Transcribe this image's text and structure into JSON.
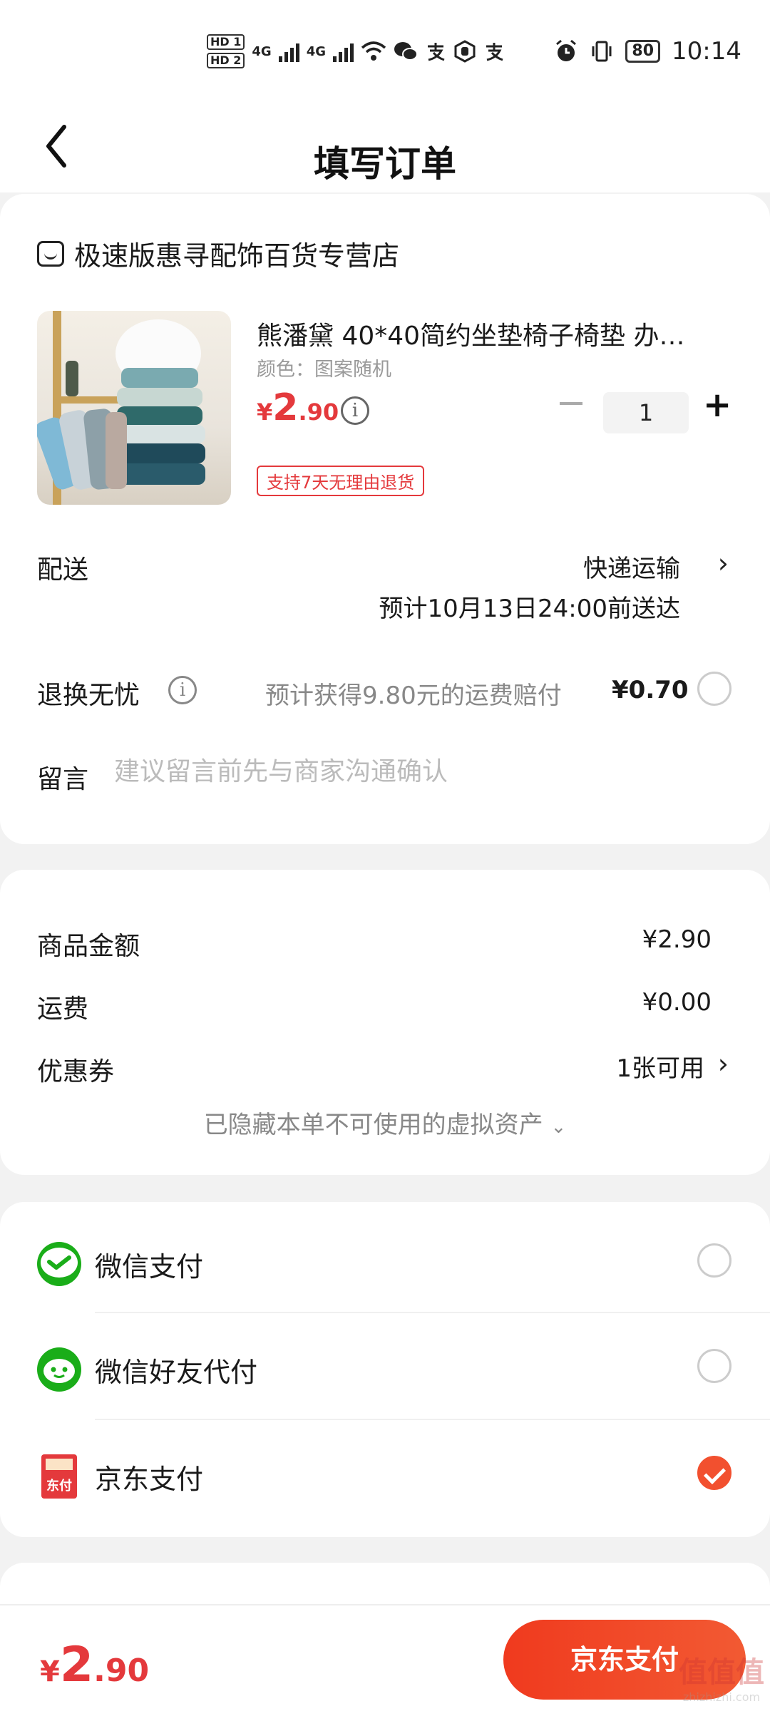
{
  "status_bar": {
    "hd1": "HD 1",
    "hd2": "HD 2",
    "net1": "4G",
    "net2": "4G",
    "battery": "80",
    "time": "10:14"
  },
  "nav": {
    "title": "填写订单"
  },
  "shop": {
    "name": "极速版惠寻配饰百货专营店"
  },
  "product": {
    "title": "熊潘黛 40*40简约坐垫椅子椅垫 办…",
    "attr": "颜色：图案随机",
    "price_currency": "¥",
    "price_int": "2",
    "price_dec": ".90",
    "info_glyph": "i",
    "quantity": "1",
    "return_tag": "支持7天无理由退货"
  },
  "delivery": {
    "label": "配送",
    "method": "快递运输",
    "eta": "预计10月13日24:00前送达"
  },
  "exchange": {
    "label": "退换无忧",
    "desc": "预计获得9.80元的运费赔付",
    "fee": "¥0.70"
  },
  "message": {
    "label": "留言",
    "placeholder": "建议留言前先与商家沟通确认"
  },
  "summary": {
    "goods_label": "商品金额",
    "goods_value": "¥2.90",
    "freight_label": "运费",
    "freight_value": "¥0.00",
    "coupon_label": "优惠券",
    "coupon_value": "1张可用",
    "hidden_assets": "已隐藏本单不可使用的虚拟资产"
  },
  "payment": {
    "options": [
      {
        "label": "微信支付",
        "icon": "wechat-pay-icon",
        "selected": false
      },
      {
        "label": "微信好友代付",
        "icon": "wechat-friend-pay-icon",
        "selected": false
      },
      {
        "label": "京东支付",
        "icon": "jd-pay-icon",
        "selected": true
      }
    ],
    "jd_icon_text": "东付"
  },
  "bottom": {
    "total_currency": "¥",
    "total_int": "2",
    "total_dec": ".90",
    "pay_button": "京东支付"
  },
  "watermark": {
    "main": "值值值",
    "sub": "zhizhizhi.com"
  },
  "colors": {
    "accent": "#e4393c",
    "button": "#f03a1e",
    "wechat": "#1aad19"
  }
}
